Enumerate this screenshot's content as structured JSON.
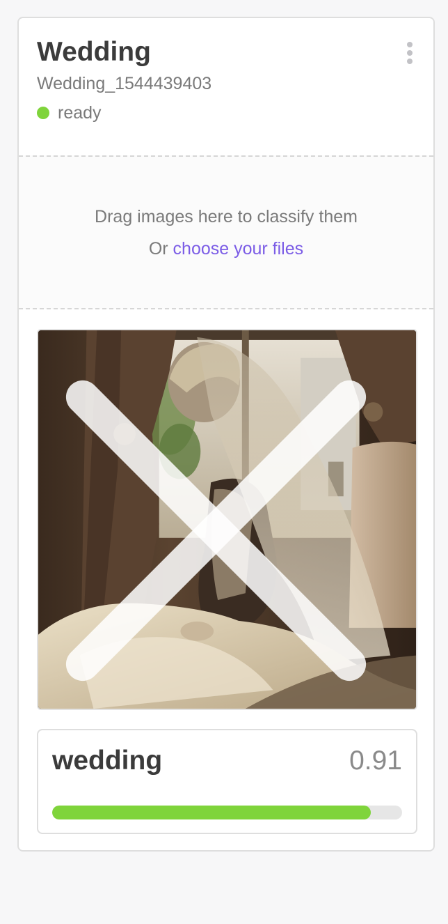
{
  "model": {
    "title": "Wedding",
    "id": "Wedding_1544439403",
    "status": "ready",
    "status_color": "#7fd43b"
  },
  "menu": {
    "icon": "kebab-menu-icon"
  },
  "dropzone": {
    "prompt": "Drag images here to classify them",
    "or_text": "Or ",
    "link_text": "choose your files"
  },
  "photo": {
    "close_icon": "close-icon"
  },
  "result": {
    "label": "wedding",
    "score": "0.91",
    "progress": 0.91,
    "bar_color": "#7fd43b"
  }
}
